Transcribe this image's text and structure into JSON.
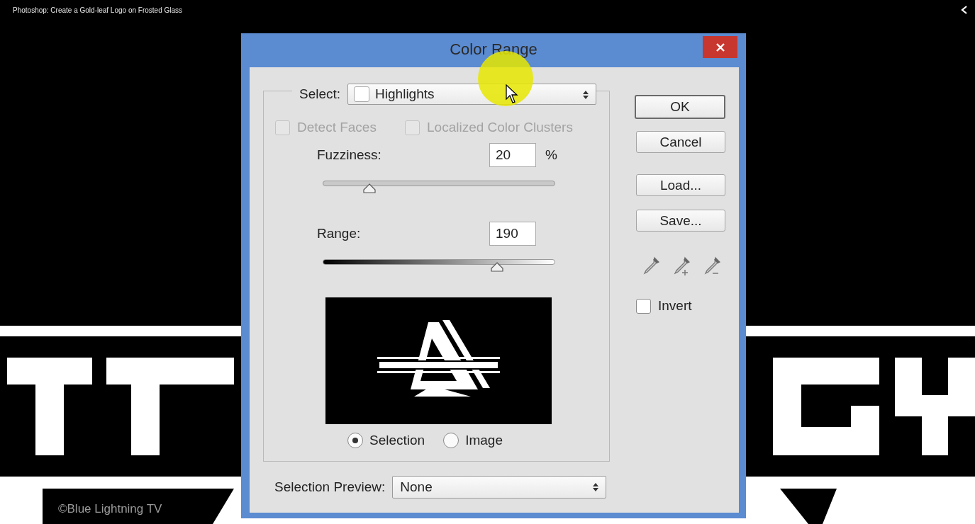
{
  "video_title": "Photoshop: Create a Gold-leaf Logo on Frosted Glass",
  "dialog": {
    "title": "Color Range",
    "select": {
      "label": "Select:",
      "value": "Highlights"
    },
    "options": [
      {
        "label": "Detect Faces",
        "checked": false,
        "disabled": true
      },
      {
        "label": "Localized Color Clusters",
        "checked": false,
        "disabled": true
      }
    ],
    "sliders": [
      {
        "label": "Fuzziness:",
        "value": "20",
        "unit": "%",
        "level": 0.2,
        "kind": "plain"
      },
      {
        "label": "Range:",
        "value": "190",
        "level": 0.75,
        "kind": "gradient"
      }
    ],
    "view_modes": [
      {
        "label": "Selection",
        "selected": true
      },
      {
        "label": "Image",
        "selected": false
      }
    ],
    "selection_preview": {
      "label": "Selection Preview:",
      "value": "None"
    },
    "buttons": [
      {
        "label": "OK",
        "default": true
      },
      {
        "label": "Cancel",
        "default": false
      },
      {
        "label": "Load...",
        "default": false
      },
      {
        "label": "Save...",
        "default": false
      }
    ],
    "invert": {
      "label": "Invert",
      "checked": false
    }
  },
  "credit": "©Blue Lightning TV"
}
